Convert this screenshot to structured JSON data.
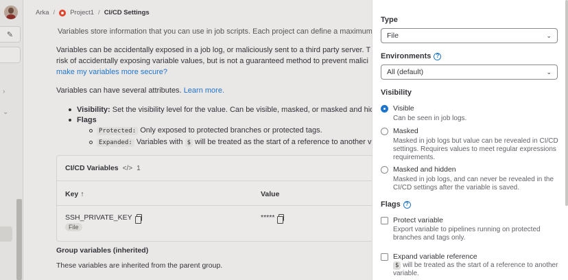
{
  "breadcrumb": {
    "group": "Arka",
    "project": "Project1",
    "page": "CI/CD Settings"
  },
  "intro": {
    "line1": "Variables store information that you can use in job scripts. Each project can define a maximum",
    "line2": "Variables can be accidentally exposed in a job log, or maliciously sent to a third party server. T",
    "line3": "risk of accidentally exposing variable values, but is not a guaranteed method to prevent malici",
    "link1": "make my variables more secure?",
    "attrs": "Variables can have several attributes.",
    "learn_more": "Learn more."
  },
  "bullets": {
    "visibility_label": "Visibility:",
    "visibility_text": "Set the visibility level for the value. Can be visible, masked, or masked and hid",
    "flags_label": "Flags",
    "protected_code": "Protected:",
    "protected_text": "Only exposed to protected branches or protected tags.",
    "expanded_code": "Expanded:",
    "expanded_pre": "Variables with",
    "expanded_sym": "$",
    "expanded_post": "will be treated as the start of a reference to another v"
  },
  "table": {
    "title": "CI/CD Variables",
    "count_icon": "</>",
    "count": "1",
    "col_key": "Key",
    "sort_icon": "↑",
    "col_value": "Value",
    "rows": [
      {
        "key": "SSH_PRIVATE_KEY",
        "value": "*****",
        "type": "File"
      }
    ]
  },
  "group": {
    "title": "Group variables (inherited)",
    "desc": "These variables are inherited from the parent group."
  },
  "drawer": {
    "type_label": "Type",
    "type_value": "File",
    "env_label": "Environments",
    "env_value": "All (default)",
    "visibility_label": "Visibility",
    "visibility_options": [
      {
        "label": "Visible",
        "hint": "Can be seen in job logs.",
        "selected": true
      },
      {
        "label": "Masked",
        "hint": "Masked in job logs but value can be revealed in CI/CD settings. Requires values to meet regular expressions requirements.",
        "selected": false
      },
      {
        "label": "Masked and hidden",
        "hint": "Masked in job logs, and can never be revealed in the CI/CD settings after the variable is saved.",
        "selected": false
      }
    ],
    "flags_label": "Flags",
    "flags": [
      {
        "label": "Protect variable",
        "hint": "Export variable to pipelines running on protected branches and tags only."
      },
      {
        "label": "Expand variable reference",
        "hint_sym": "$",
        "hint": "will be treated as the start of a reference to another variable."
      }
    ]
  },
  "colors": {
    "accent": "#1f75cb",
    "page_bg": "#e9e8e6",
    "drawer_bg": "#ffffff"
  }
}
